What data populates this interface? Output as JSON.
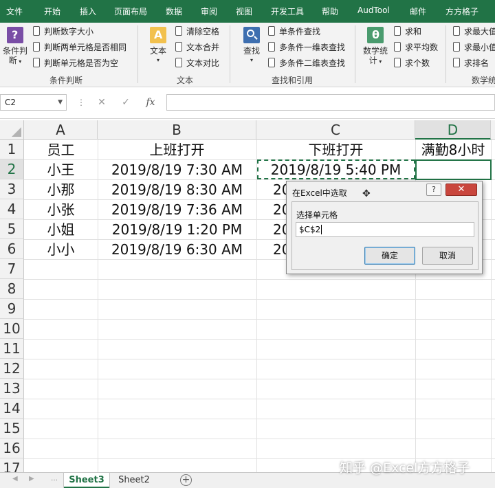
{
  "menu": {
    "tabs": [
      "文件",
      "开始",
      "插入",
      "页面布局",
      "数据",
      "审阅",
      "视图",
      "开发工具",
      "帮助",
      "AudTool",
      "邮件",
      "方方格子"
    ]
  },
  "ribbon": {
    "condition": {
      "big_label_line1": "条件判",
      "big_label_line2": "断",
      "items": [
        "判断数字大小",
        "判断两单元格是否相同",
        "判断单元格是否为空"
      ],
      "group_label": "条件判断"
    },
    "text": {
      "big_label": "文本",
      "items": [
        "清除空格",
        "文本合并",
        "文本对比"
      ],
      "group_label": "文本"
    },
    "lookup": {
      "big_label": "查找",
      "items": [
        "单条件查找",
        "多条件一维表查找",
        "多条件二维表查找"
      ],
      "group_label": "查找和引用"
    },
    "stats": {
      "big_label_line1": "数学统",
      "big_label_line2": "计",
      "items": [
        "求和",
        "求平均数",
        "求个数"
      ],
      "items2": [
        "求最大值",
        "求最小值",
        "求排名"
      ],
      "group_label": "数学统计"
    }
  },
  "formula_bar": {
    "name_box": "C2",
    "cancel_icon": "✕",
    "enter_icon": "✓",
    "fx_label": "fx",
    "formula": ""
  },
  "sheet": {
    "columns": [
      "A",
      "B",
      "C",
      "D"
    ],
    "row_numbers": [
      "1",
      "2",
      "3",
      "4",
      "5",
      "6",
      "7",
      "8",
      "9",
      "10",
      "11",
      "12",
      "13",
      "14",
      "15",
      "16",
      "17"
    ],
    "headers": [
      "员工",
      "上班打开",
      "下班打开",
      "满勤8小时"
    ],
    "rows": [
      {
        "name": "小王",
        "start": "2019/8/19 7:30 AM",
        "end": "2019/8/19 5:40 PM"
      },
      {
        "name": "小那",
        "start": "2019/8/19 8:30 AM",
        "end": "20"
      },
      {
        "name": "小张",
        "start": "2019/8/19 7:36 AM",
        "end": "20"
      },
      {
        "name": "小姐",
        "start": "2019/8/19 1:20 PM",
        "end": "20"
      },
      {
        "name": "小小",
        "start": "2019/8/19 6:30 AM",
        "end": "20"
      }
    ],
    "selected_column": "D",
    "selected_row": "2"
  },
  "dialog": {
    "title": "在Excel中选取",
    "help": "?",
    "close": "✕",
    "label": "选择单元格",
    "value": "$C$2",
    "ok": "确定",
    "cancel": "取消"
  },
  "sheet_tabs": [
    "Sheet3",
    "Sheet2"
  ],
  "active_sheet": "Sheet3",
  "add_sheet": "+",
  "watermark": "知乎 @Excel方方格子",
  "colors": {
    "excel_green": "#217346",
    "ribbon_bg": "#f3f3f3",
    "close_red": "#c9463d"
  }
}
